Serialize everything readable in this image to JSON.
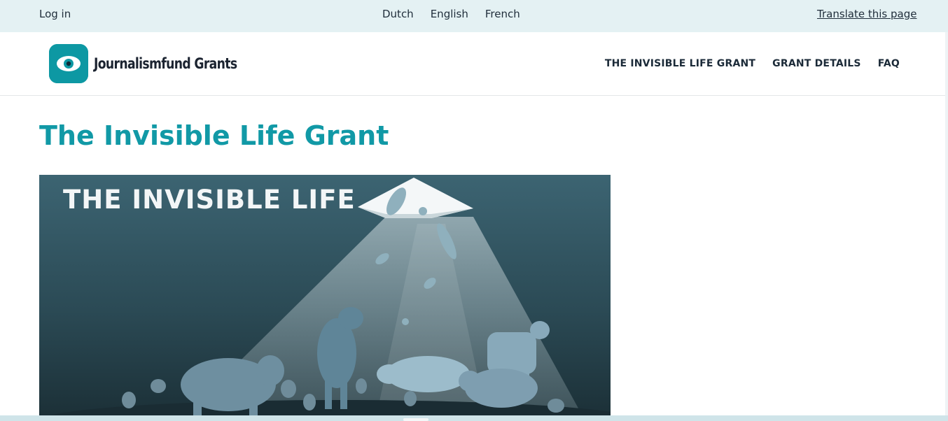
{
  "topbar": {
    "login_label": "Log in",
    "languages": [
      "Dutch",
      "English",
      "French"
    ],
    "translate_label": "Translate this page"
  },
  "header": {
    "logo_text": "Journalismfund Grants",
    "logo_icon": "eye-icon",
    "nav": [
      {
        "label": "THE INVISIBLE LIFE GRANT"
      },
      {
        "label": "GRANT DETAILS"
      },
      {
        "label": "FAQ"
      }
    ]
  },
  "main": {
    "title": "The Invisible Life Grant",
    "hero": {
      "text": "THE INVISIBLE LIFE",
      "background_color": "#2f4f5a",
      "light_color": "#e8eef0"
    }
  },
  "colors": {
    "topbar_bg": "#e4f1f3",
    "accent": "#0d98a3",
    "title": "#1199a6",
    "nav_text": "#1b2a38"
  }
}
